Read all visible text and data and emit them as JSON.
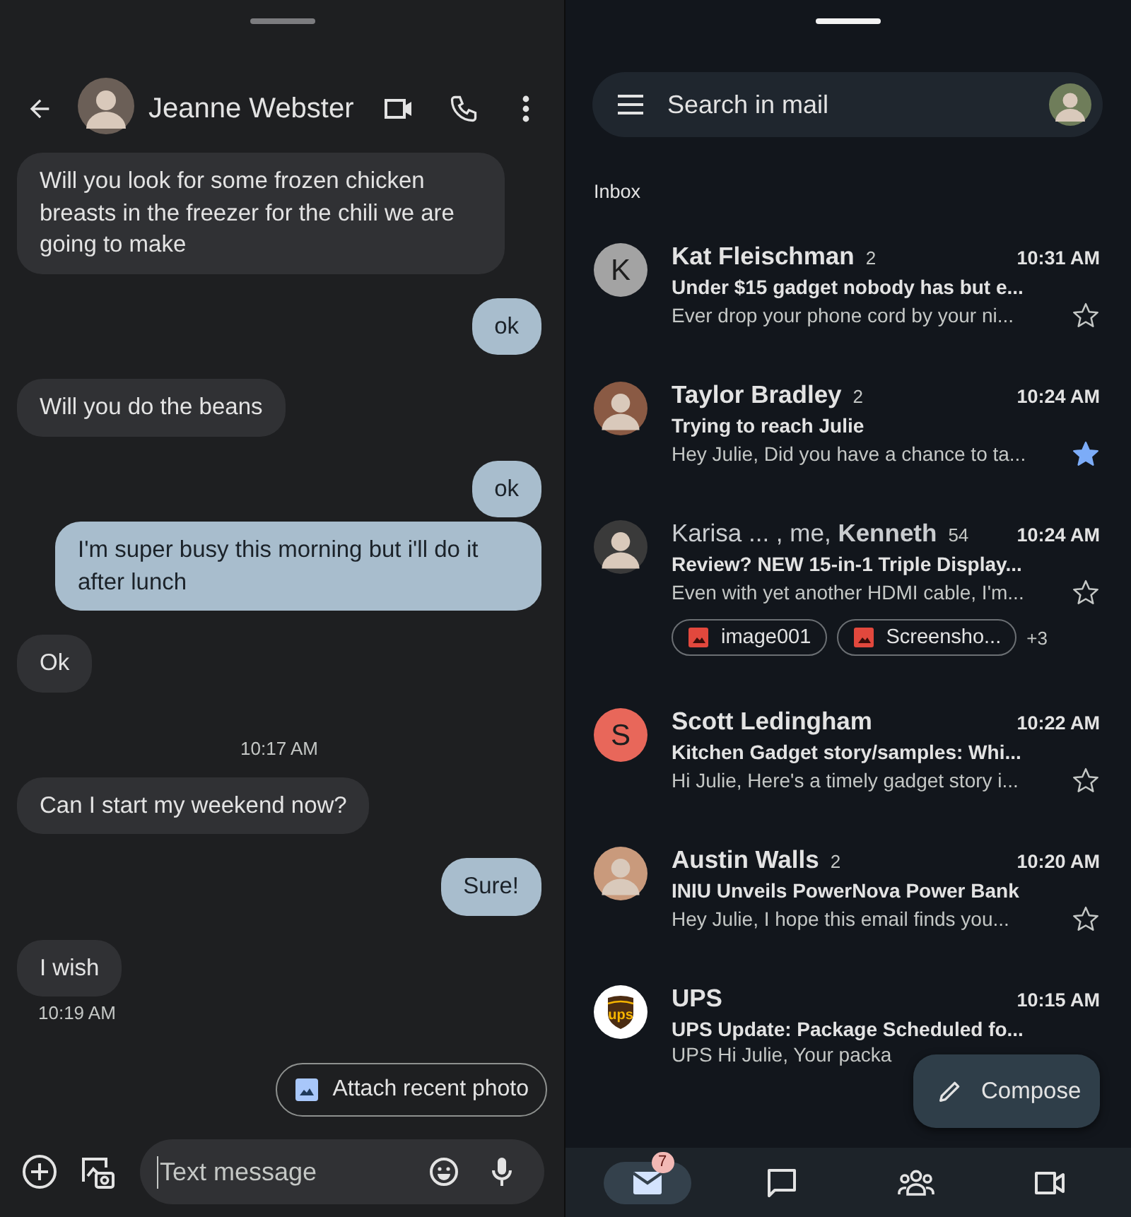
{
  "chat": {
    "contact": "Jeanne Webster",
    "messages": [
      {
        "kind": "in",
        "text": "Will you look for some frozen chicken breasts in the freezer for the chili we are going to make"
      },
      {
        "kind": "out",
        "text": "ok"
      },
      {
        "kind": "in",
        "text": "Will you do the beans"
      },
      {
        "kind": "out",
        "text": "ok"
      },
      {
        "kind": "out",
        "text": "I'm super busy this morning but i'll do it after lunch"
      },
      {
        "kind": "in",
        "text": "Ok"
      },
      {
        "kind": "time",
        "text": "10:17 AM"
      },
      {
        "kind": "in",
        "text": "Can I start my weekend now?"
      },
      {
        "kind": "out",
        "text": "Sure!"
      },
      {
        "kind": "in",
        "text": "I wish"
      },
      {
        "kind": "stamp",
        "text": "10:19 AM"
      }
    ],
    "suggestion": "Attach recent photo",
    "composer": {
      "placeholder": "Text message"
    }
  },
  "mail": {
    "search": {
      "placeholder": "Search in mail"
    },
    "folder": "Inbox",
    "emails": [
      {
        "kind": "single",
        "sender": "Kat Fleischman",
        "count": "2",
        "time": "10:31 AM",
        "subject": "Under $15 gadget nobody has but e...",
        "snippet": "Ever drop your phone cord by your ni...",
        "unread": true,
        "starred": false,
        "avatar": {
          "kind": "letter",
          "letter": "K",
          "color": "#a3a3a3"
        }
      },
      {
        "kind": "single",
        "sender": "Taylor Bradley",
        "count": "2",
        "time": "10:24 AM",
        "subject": "Trying to reach Julie",
        "snippet": "Hey Julie, Did you have a chance to ta...",
        "unread": true,
        "starred": true
      },
      {
        "kind": "thread",
        "sender": "Karisa ... , me, **Kenneth**",
        "count": "54",
        "time": "10:24 AM",
        "subject": "Review? NEW 15-in-1 Triple Display...",
        "snippet": "Even with yet another HDMI cable, I'm...",
        "unread": true,
        "starred": false,
        "attachments": [
          {
            "name": "image001"
          },
          {
            "name": "Screensho..."
          }
        ],
        "more_attachments": "+3"
      },
      {
        "kind": "single",
        "sender": "Scott Ledingham",
        "time": "10:22 AM",
        "subject": "Kitchen Gadget story/samples: Whi...",
        "snippet": "Hi Julie, Here's a timely gadget story i...",
        "unread": true,
        "starred": false,
        "avatar": {
          "kind": "letter",
          "letter": "S",
          "color": "#e8675a"
        }
      },
      {
        "kind": "single",
        "sender": "Austin Walls",
        "count": "2",
        "time": "10:20 AM",
        "subject": "INIU Unveils PowerNova Power Bank",
        "snippet": "Hey Julie, I hope this email finds you...",
        "unread": true,
        "starred": false
      },
      {
        "kind": "single",
        "sender": "UPS",
        "time": "10:15 AM",
        "subject": "UPS Update: Package Scheduled fo...",
        "snippet": "UPS Hi Julie, Your packa",
        "unread": true,
        "avatar": {
          "kind": "logo",
          "text": "ups",
          "color": "#4b2c12"
        }
      }
    ],
    "compose": "Compose",
    "nav": [
      {
        "kind": "mail",
        "selected": true,
        "badge": "7"
      },
      {
        "kind": "chat",
        "selected": false
      },
      {
        "kind": "people",
        "selected": false
      },
      {
        "kind": "video",
        "selected": false
      }
    ]
  }
}
